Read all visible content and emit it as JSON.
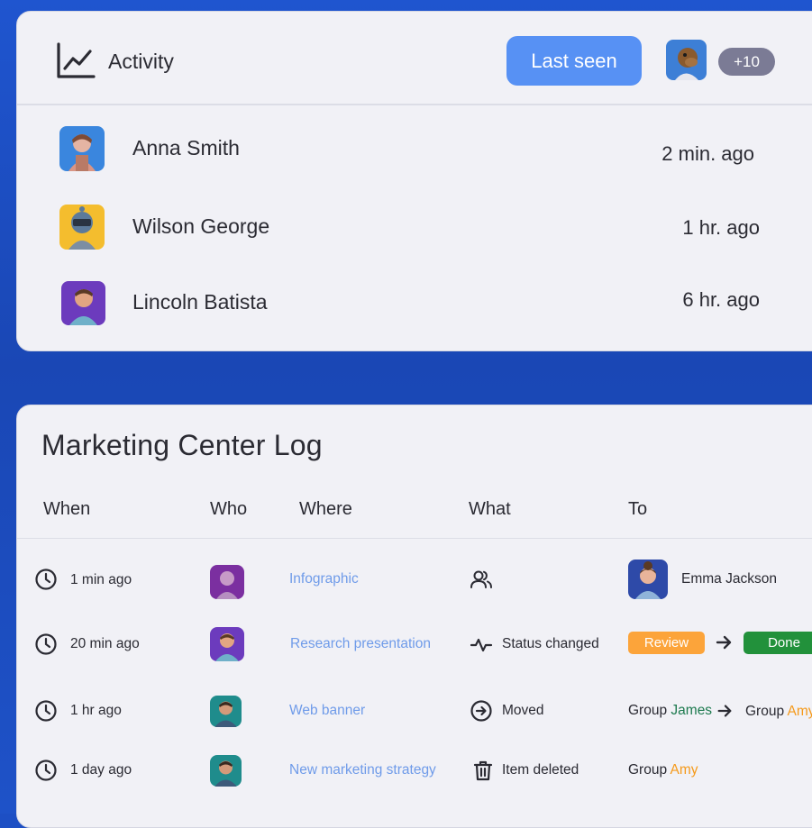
{
  "activity": {
    "title": "Activity",
    "last_seen_label": "Last seen",
    "more_count": "+10",
    "users": [
      {
        "name": "Anna Smith",
        "time": "2 min. ago"
      },
      {
        "name": "Wilson George",
        "time": "1 hr. ago"
      },
      {
        "name": "Lincoln Batista",
        "time": "6 hr. ago"
      }
    ]
  },
  "log": {
    "title": "Marketing Center Log",
    "columns": [
      "When",
      "Who",
      "Where",
      "What",
      "To"
    ],
    "rows": [
      {
        "when": "1 min ago",
        "where": "Infographic",
        "what": "",
        "to_name": "Emma Jackson"
      },
      {
        "when": "20 min ago",
        "where": "Research presentation",
        "what": "Status changed",
        "from_status": "Review",
        "to_status": "Done"
      },
      {
        "when": "1 hr ago",
        "where": "Web banner",
        "what": "Moved",
        "from_group_prefix": "Group",
        "from_group": "James",
        "to_group_prefix": "Group",
        "to_group": "Amy"
      },
      {
        "when": "1 day ago",
        "where": "New marketing strategy",
        "what": "Item deleted",
        "group_prefix": "Group",
        "group": "Amy"
      }
    ]
  },
  "colors": {
    "background": "#1d4fc4",
    "card": "#f1f1f6",
    "accent_button": "#5791f4",
    "link": "#6f9be9",
    "review": "#fca43a",
    "done": "#22913b",
    "group_green": "#1d7a4f",
    "group_orange": "#f59a1b"
  },
  "icons": [
    "line-chart-icon",
    "clock-icon",
    "people-icon",
    "activity-pulse-icon",
    "arrow-circle-right-icon",
    "trash-icon",
    "arrow-right-icon"
  ]
}
